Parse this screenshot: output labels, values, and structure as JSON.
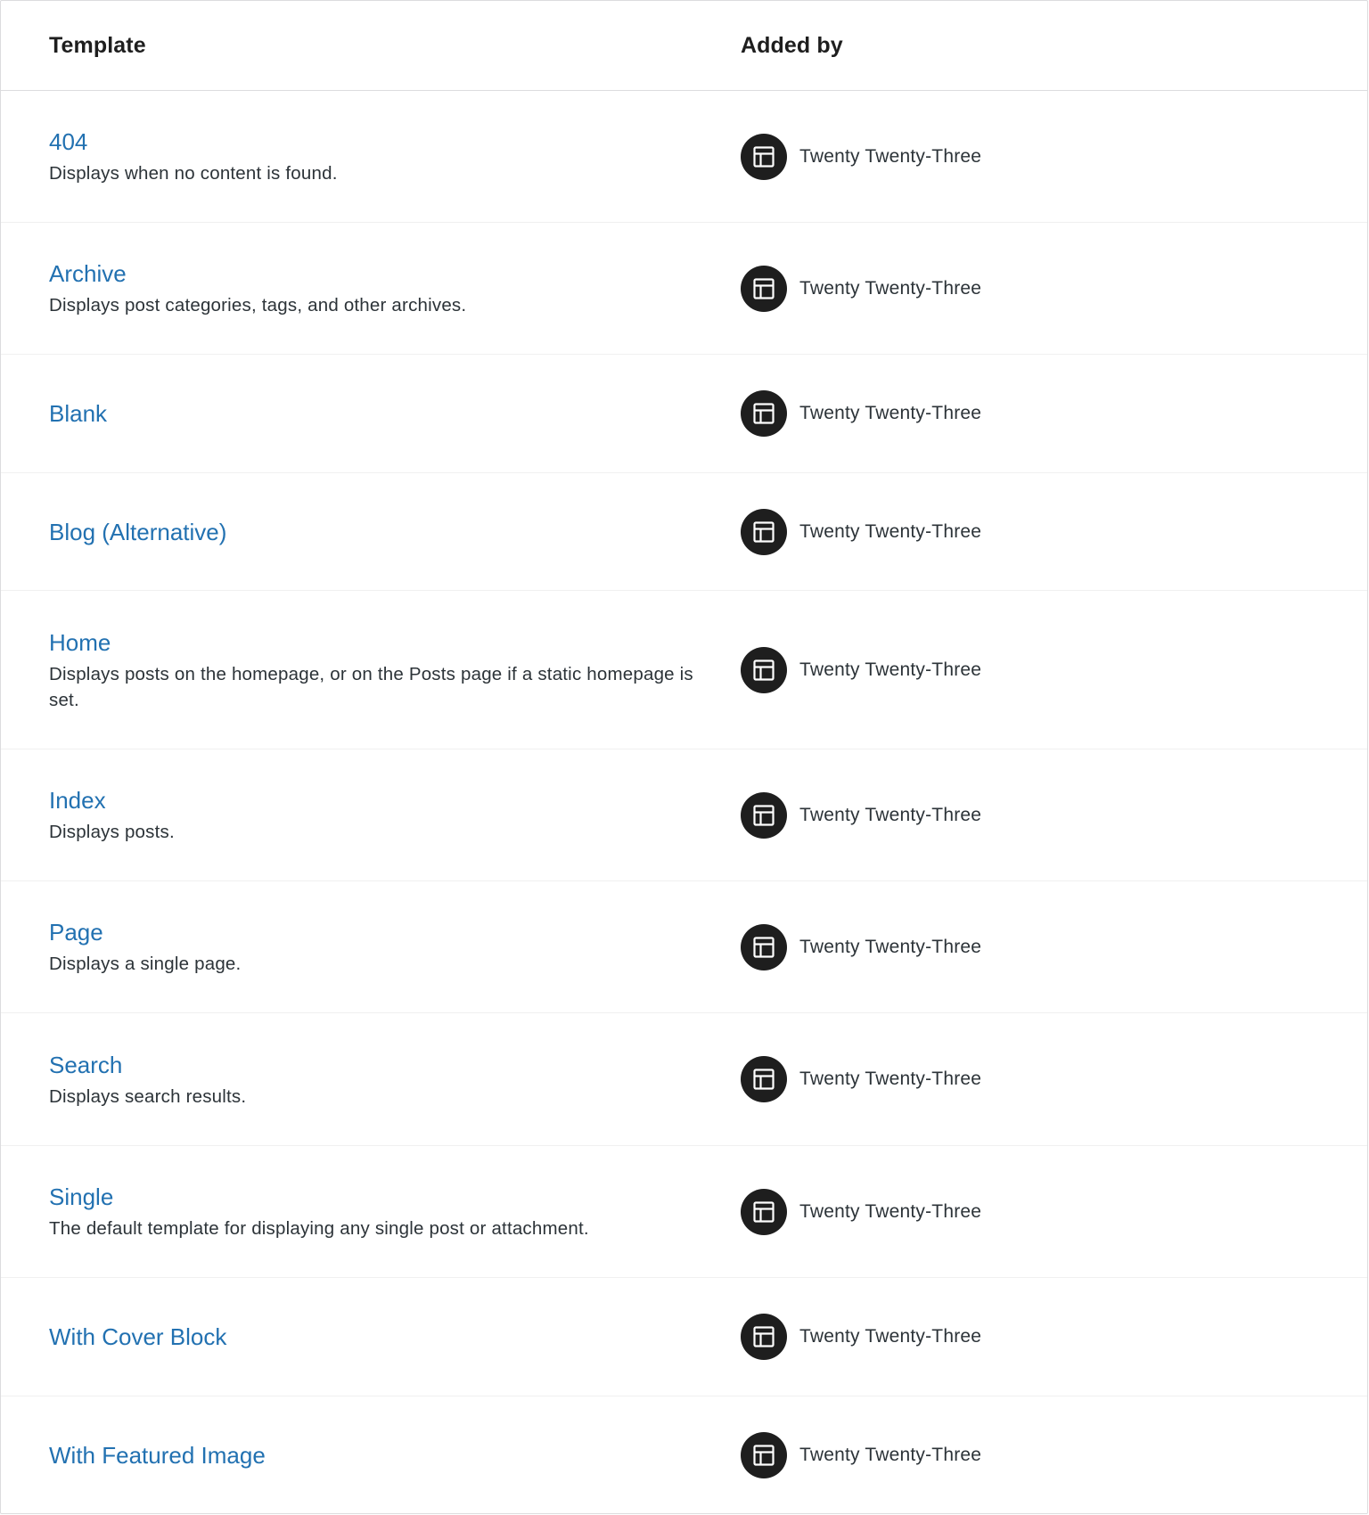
{
  "header": {
    "template_label": "Template",
    "added_by_label": "Added by"
  },
  "rows": [
    {
      "title": "404",
      "description": "Displays when no content is found.",
      "added_by": "Twenty Twenty-Three",
      "icon": "layout-icon"
    },
    {
      "title": "Archive",
      "description": "Displays post categories, tags, and other archives.",
      "added_by": "Twenty Twenty-Three",
      "icon": "layout-icon"
    },
    {
      "title": "Blank",
      "description": "",
      "added_by": "Twenty Twenty-Three",
      "icon": "layout-icon"
    },
    {
      "title": "Blog (Alternative)",
      "description": "",
      "added_by": "Twenty Twenty-Three",
      "icon": "layout-icon"
    },
    {
      "title": "Home",
      "description": "Displays posts on the homepage, or on the Posts page if a static homepage is set.",
      "added_by": "Twenty Twenty-Three",
      "icon": "layout-icon"
    },
    {
      "title": "Index",
      "description": "Displays posts.",
      "added_by": "Twenty Twenty-Three",
      "icon": "layout-icon"
    },
    {
      "title": "Page",
      "description": "Displays a single page.",
      "added_by": "Twenty Twenty-Three",
      "icon": "layout-icon"
    },
    {
      "title": "Search",
      "description": "Displays search results.",
      "added_by": "Twenty Twenty-Three",
      "icon": "layout-icon"
    },
    {
      "title": "Single",
      "description": "The default template for displaying any single post or attachment.",
      "added_by": "Twenty Twenty-Three",
      "icon": "layout-icon"
    },
    {
      "title": "With Cover Block",
      "description": "",
      "added_by": "Twenty Twenty-Three",
      "icon": "layout-icon"
    },
    {
      "title": "With Featured Image",
      "description": "",
      "added_by": "Twenty Twenty-Three",
      "icon": "layout-icon"
    }
  ]
}
